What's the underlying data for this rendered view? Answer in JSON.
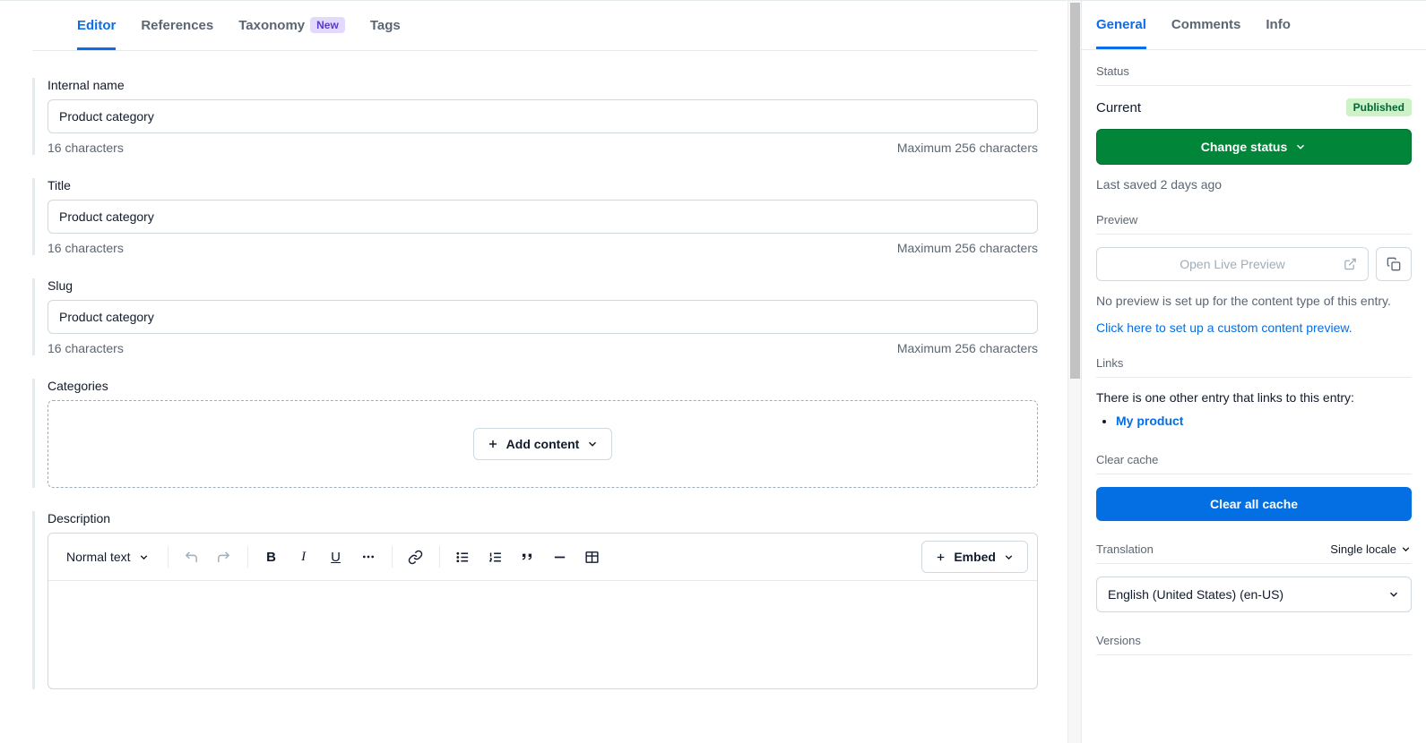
{
  "tabs": {
    "editor": "Editor",
    "references": "References",
    "taxonomy": "Taxonomy",
    "taxonomy_badge": "New",
    "tags": "Tags"
  },
  "fields": {
    "internal_name": {
      "label": "Internal name",
      "value": "Product category",
      "count": "16 characters",
      "max": "Maximum 256 characters"
    },
    "title": {
      "label": "Title",
      "value": "Product category",
      "count": "16 characters",
      "max": "Maximum 256 characters"
    },
    "slug": {
      "label": "Slug",
      "value": "Product category",
      "count": "16 characters",
      "max": "Maximum 256 characters"
    },
    "categories": {
      "label": "Categories",
      "add_button": "Add content"
    },
    "description": {
      "label": "Description",
      "text_style": "Normal text",
      "embed": "Embed"
    }
  },
  "sidebar": {
    "tabs": {
      "general": "General",
      "comments": "Comments",
      "info": "Info"
    },
    "status": {
      "header": "Status",
      "current_label": "Current",
      "current_value": "Published",
      "change_button": "Change status",
      "last_saved": "Last saved 2 days ago"
    },
    "preview": {
      "header": "Preview",
      "open_label": "Open Live Preview",
      "note": "No preview is set up for the content type of this entry.",
      "setup_link": "Click here to set up a custom content preview."
    },
    "links": {
      "header": "Links",
      "note": "There is one other entry that links to this entry:",
      "items": [
        "My product"
      ]
    },
    "cache": {
      "header": "Clear cache",
      "button": "Clear all cache"
    },
    "translation": {
      "header": "Translation",
      "mode": "Single locale",
      "value": "English (United States) (en-US)"
    },
    "versions": {
      "header": "Versions"
    }
  }
}
